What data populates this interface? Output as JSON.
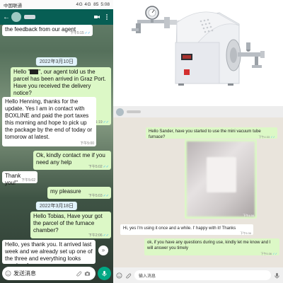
{
  "phone": {
    "status": {
      "carrier": "中国联通",
      "signal": "4G 4G",
      "battery": "85",
      "time": "5:08"
    },
    "header": {
      "back_icon": "arrow-left-icon",
      "avatar_icon": "avatar-icon",
      "call_icon": "video-icon",
      "menu_icon": "more-icon"
    },
    "messages": [
      {
        "kind": "in",
        "text": "the feedback from our agent",
        "time": "下午5:15",
        "ticks": "✓✓"
      },
      {
        "kind": "date",
        "text": "2022年3月10日"
      },
      {
        "kind": "out",
        "pre": "Hello \"",
        "post": "\", our agent told us the parcel has been arrived in Graz Port. Have you received the delivery notice?",
        "time": "上午11:19",
        "ticks": "✓✓"
      },
      {
        "kind": "in",
        "text": "Hello Henning, thanks for the update. Yes I am in contact with BOXLINE and paid the port taxes this morning and hope to pick up the package by the end of today or tomorow at latest.",
        "time": "下午5:00"
      },
      {
        "kind": "out",
        "text": "Ok, kindly contact me if you need any help",
        "time": "下午5:02",
        "ticks": "✓✓"
      },
      {
        "kind": "in",
        "text": "Thank you!\"",
        "time": "下午5:02"
      },
      {
        "kind": "out",
        "text": "my pleasure",
        "time": "下午5:03",
        "ticks": "✓✓"
      },
      {
        "kind": "date",
        "text": "2022年3月18日"
      },
      {
        "kind": "out",
        "text": "Hello Tobias, Have your got the parcel of the furnace chamber?",
        "time": "下午2:06",
        "ticks": "✓✓"
      },
      {
        "kind": "in",
        "text": "Hello, yes thank you. It arrived last week and we already set up one of the three and everything looks good so far."
      }
    ],
    "input": {
      "placeholder": "发送消息",
      "emoji_icon": "emoji-icon",
      "attach_icon": "paperclip-icon",
      "camera_icon": "camera-icon",
      "mic_icon": "mic-icon"
    },
    "scroll_icon": "chevrons-down-icon"
  },
  "desktop": {
    "messages": [
      {
        "kind": "out",
        "text": "Hello Sander, have you started to use the mini vacuum tube furnace?",
        "time": "下午4:33",
        "ticks": "✓✓"
      },
      {
        "kind": "image",
        "time": "下午4:56"
      },
      {
        "kind": "in",
        "text": "Hi, yes I'm using it once and a while. I' happy with it! Thanks",
        "time": "下午5:36"
      },
      {
        "kind": "out",
        "text": "ok, if you have any questions during use, kindly let me know and I will answer you timely",
        "time": "下午5:36",
        "ticks": "✓✓"
      }
    ],
    "input": {
      "placeholder": "输入消息",
      "emoji_icon": "emoji-icon",
      "attach_icon": "paperclip-icon",
      "mic_icon": "mic-icon"
    }
  },
  "colors": {
    "whatsapp_header": "#075e54",
    "out_bubble": "#dcf8c6",
    "in_bubble": "#ffffff",
    "desktop_bg": "#e9e4dc",
    "read_ticks": "#34b7f1",
    "mic_button": "#00a884"
  }
}
